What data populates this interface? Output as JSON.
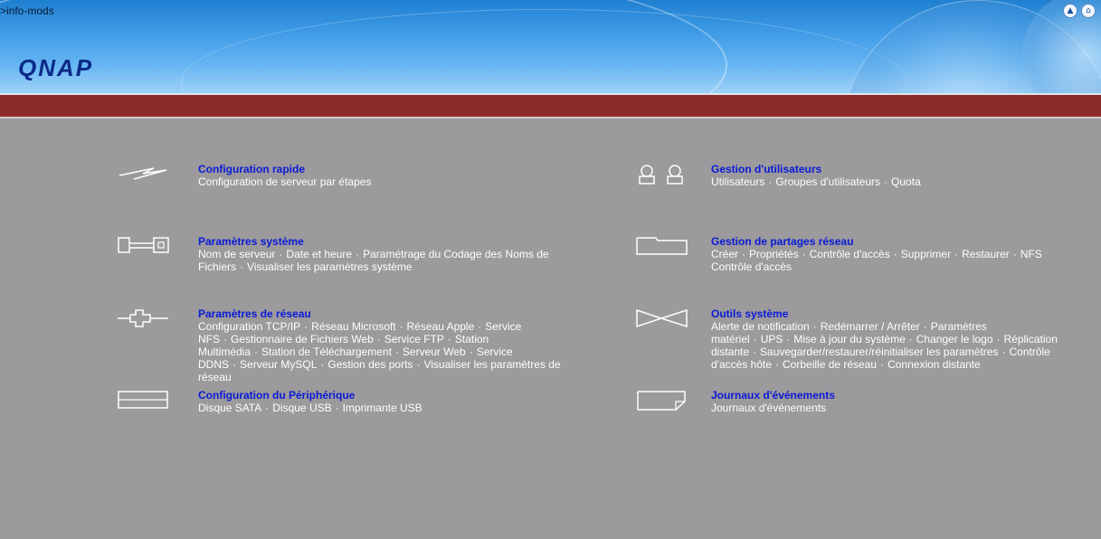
{
  "header": {
    "breadcrumb": ">info-mods",
    "logo": "QNAP",
    "icons": [
      "up-arrow-icon",
      "home-icon"
    ]
  },
  "left": [
    {
      "title": "Configuration rapide",
      "icon": "lightning-icon",
      "links": [
        "Configuration de serveur par étapes"
      ]
    },
    {
      "title": "Paramètres système",
      "icon": "wrench-icon",
      "links": [
        "Nom de serveur",
        "Date et heure",
        "Paramétrage du Codage des Noms de Fichiers",
        "Visualiser les paramètres système"
      ]
    },
    {
      "title": "Paramètres de réseau",
      "icon": "network-plug-icon",
      "links": [
        "Configuration TCP/IP",
        "Réseau Microsoft",
        "Réseau Apple",
        "Service NFS",
        "Gestionnaire de Fichiers Web",
        "Service FTP",
        "Station Multimédia",
        "Station de Téléchargement",
        "Serveur Web",
        "Service DDNS",
        "Serveur MySQL",
        "Gestion des ports",
        "Visualiser les paramètres de réseau"
      ]
    },
    {
      "title": "Configuration du Périphérique",
      "icon": "device-icon",
      "links": [
        "Disque SATA",
        "Disque USB",
        "Imprimante USB"
      ]
    }
  ],
  "right": [
    {
      "title": "Gestion d'utilisateurs",
      "icon": "users-icon",
      "links": [
        "Utilisateurs",
        "Groupes d'utilisateurs",
        "Quota"
      ]
    },
    {
      "title": "Gestion de partages réseau",
      "icon": "folder-icon",
      "links": [
        "Créer",
        "Propriétés",
        "Contrôle d'accès",
        "Supprimer",
        "Restaurer",
        "NFS Contrôle d'accès"
      ]
    },
    {
      "title": "Outils système",
      "icon": "tools-icon",
      "links": [
        "Alerte de notification",
        "Redémarrer / Arrêter",
        "Paramètres matériel",
        "UPS",
        "Mise à jour du système",
        "Changer le logo",
        "Réplication distante",
        "Sauvegarder/restaurer/réinitialiser les paramètres",
        "Contrôle d'accès hôte",
        "Corbeille de réseau",
        "Connexion distante"
      ]
    },
    {
      "title": "Journaux d'événements",
      "icon": "log-icon",
      "links": [
        "Journaux d'événements"
      ]
    }
  ]
}
